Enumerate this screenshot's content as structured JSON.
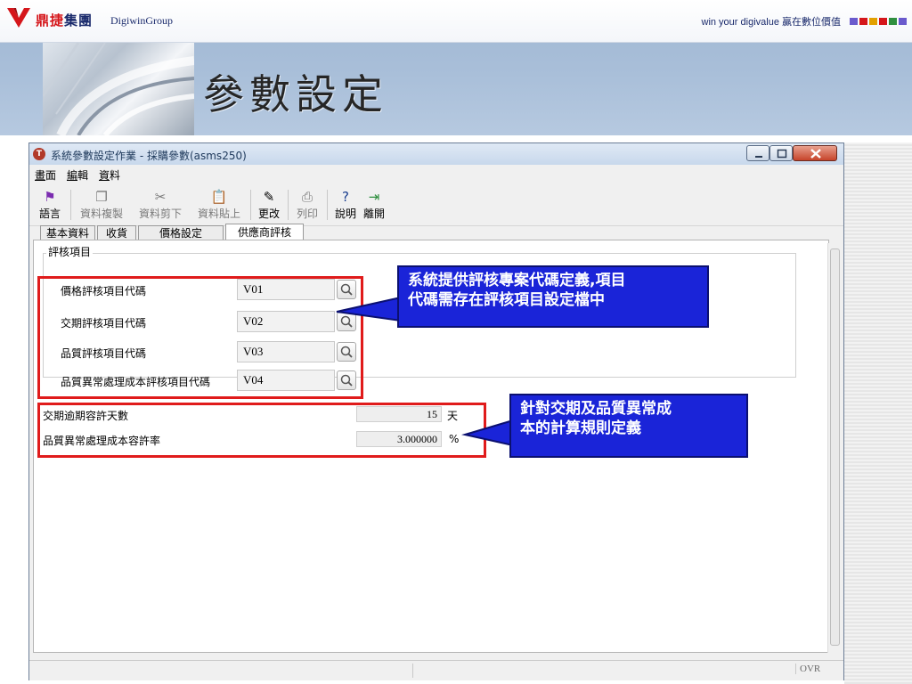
{
  "slide": {
    "brand": {
      "name_red": "鼎捷",
      "name_blue": "集團",
      "name_en": "DigiwinGroup",
      "slogan": "win your digivalue 贏在數位價值"
    },
    "title": "參數設定",
    "colors": {
      "accent_blue": "#1a24d8",
      "highlight_red": "#e01b1b",
      "header_blue": "#a9bfd9"
    }
  },
  "window": {
    "title": "系統參數設定作業 - 採購參數(asms250)",
    "controls": [
      "minimize-icon",
      "maximize-icon",
      "close-icon"
    ]
  },
  "menu": {
    "items": [
      {
        "label": "畫面",
        "underline": "畫"
      },
      {
        "label": "編輯",
        "underline": "編"
      },
      {
        "label": "資料",
        "underline": "資"
      }
    ]
  },
  "toolbar": {
    "items": [
      {
        "label": "語言",
        "icon": "flag-icon",
        "enabled": true
      },
      {
        "label": "資料複製",
        "icon": "copy-icon",
        "enabled": false
      },
      {
        "label": "資料剪下",
        "icon": "cut-icon",
        "enabled": false
      },
      {
        "label": "資料貼上",
        "icon": "paste-icon",
        "enabled": false
      },
      {
        "label": "更改",
        "icon": "pencil-icon",
        "enabled": true
      },
      {
        "label": "列印",
        "icon": "printer-icon",
        "enabled": false
      },
      {
        "label": "說明",
        "icon": "help-icon",
        "enabled": true
      },
      {
        "label": "離開",
        "icon": "exit-icon",
        "enabled": true
      }
    ]
  },
  "tabs": [
    {
      "label": "基本資料",
      "active": false
    },
    {
      "label": "收貨",
      "active": false
    },
    {
      "label": "價格設定",
      "active": false
    },
    {
      "label": "供應商評核",
      "active": true
    }
  ],
  "form": {
    "group_label": "評核項目",
    "evaluation_items": [
      {
        "label": "價格評核項目代碼",
        "value": "V01"
      },
      {
        "label": "交期評核項目代碼",
        "value": "V02"
      },
      {
        "label": "品質評核項目代碼",
        "value": "V03"
      },
      {
        "label": "品質異常處理成本評核項目代碼",
        "value": "V04"
      }
    ],
    "tolerance": [
      {
        "label": "交期逾期容許天數",
        "value": "15",
        "unit": "天"
      },
      {
        "label": "品質異常處理成本容許率",
        "value": "3.000000",
        "unit": "%"
      }
    ]
  },
  "status": {
    "mode": "OVR"
  },
  "annotations": {
    "callout_1": [
      "系統提供評核專案代碼定義,項目",
      "代碼需存在評核項目設定檔中"
    ],
    "callout_2": [
      "針對交期及品質異常成",
      "本的計算規則定義"
    ]
  }
}
